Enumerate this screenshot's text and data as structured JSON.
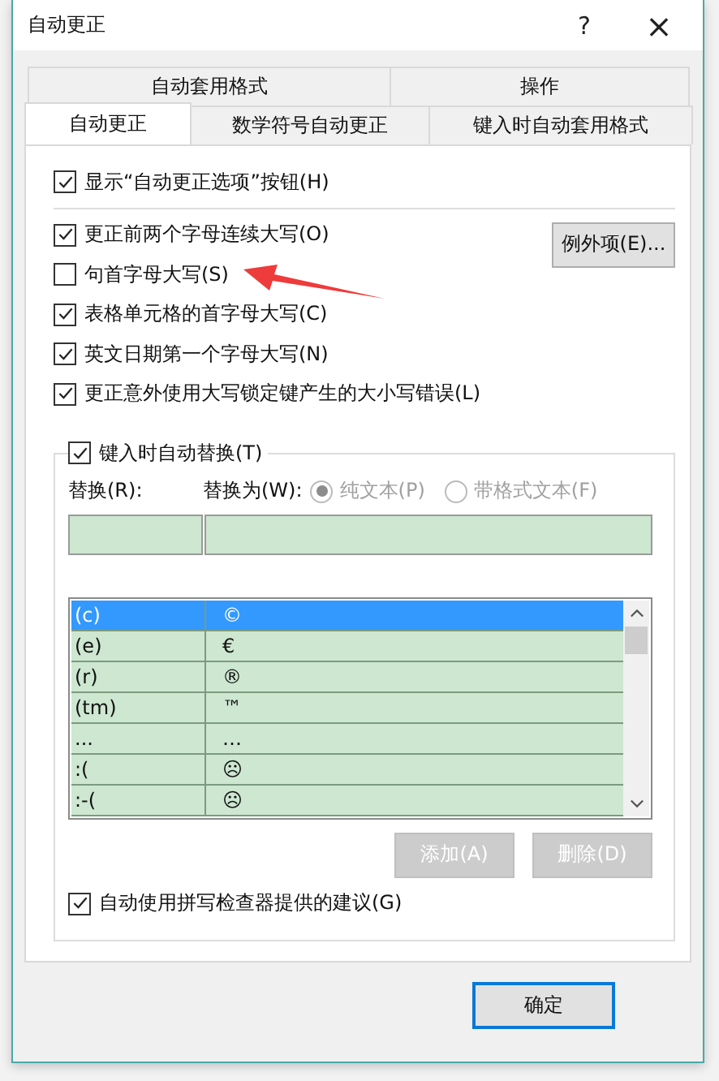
{
  "window": {
    "title": "自动更正",
    "help": "?",
    "close": "×"
  },
  "tab_rows": [
    [
      {
        "label": "自动套用格式",
        "selected": false
      },
      {
        "label": "操作",
        "selected": false
      }
    ],
    [
      {
        "label": "自动更正",
        "selected": true
      },
      {
        "label": "数学符号自动更正",
        "selected": false
      },
      {
        "label": "键入时自动套用格式",
        "selected": false
      }
    ]
  ],
  "top_option": {
    "label": "显示“自动更正选项”按钮(H)",
    "checked": true
  },
  "options": [
    {
      "label": "更正前两个字母连续大写(O)",
      "checked": true
    },
    {
      "label": "句首字母大写(S)",
      "checked": false
    },
    {
      "label": "表格单元格的首字母大写(C)",
      "checked": true
    },
    {
      "label": "英文日期第一个字母大写(N)",
      "checked": true
    },
    {
      "label": "更正意外使用大写锁定键产生的大小写错误(L)",
      "checked": true
    }
  ],
  "exceptions_button": "例外项(E)...",
  "replace": {
    "label": "键入时自动替换(T)",
    "checked": true,
    "replace_label": "替换(R):",
    "with_label": "替换为(W):",
    "radios": [
      {
        "label": "纯文本(P)",
        "selected": true,
        "disabled": true
      },
      {
        "label": "带格式文本(F)",
        "selected": false,
        "disabled": true
      }
    ],
    "entries": [
      {
        "from": "(c)",
        "to": "©",
        "selected": true
      },
      {
        "from": "(e)",
        "to": "€",
        "selected": false
      },
      {
        "from": "(r)",
        "to": "®",
        "selected": false
      },
      {
        "from": "(tm)",
        "to": "™",
        "selected": false
      },
      {
        "from": "...",
        "to": "…",
        "selected": false
      },
      {
        "from": ":(",
        "to": "☹",
        "selected": false
      },
      {
        "from": ":-(",
        "to": "☹",
        "selected": false
      }
    ],
    "buttons": [
      {
        "label": "添加(A)",
        "disabled": true
      },
      {
        "label": "删除(D)",
        "disabled": true
      }
    ],
    "spell_option": {
      "label": "自动使用拼写检查器提供的建议(G)",
      "checked": true
    }
  },
  "buttons": [
    {
      "label": "确定"
    }
  ]
}
